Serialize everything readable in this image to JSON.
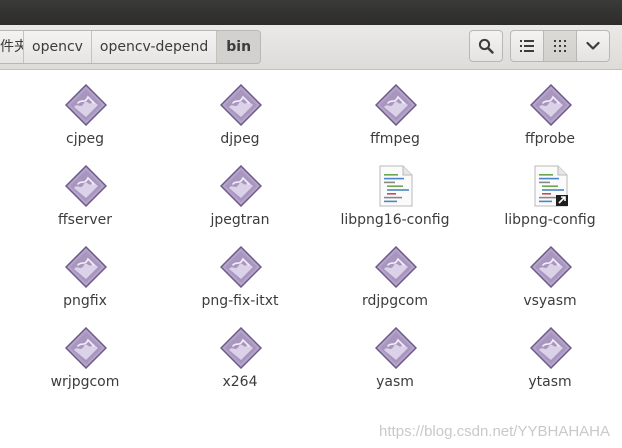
{
  "breadcrumbs": [
    "件夹",
    "opencv",
    "opencv-depend",
    "bin"
  ],
  "toolbar": {
    "search_icon": "search-icon",
    "list_view_icon": "list-view-icon",
    "grid_view_icon": "grid-view-icon",
    "menu_icon": "chevron-down-icon"
  },
  "files": [
    {
      "name": "cjpeg",
      "icon": "executable"
    },
    {
      "name": "djpeg",
      "icon": "executable"
    },
    {
      "name": "ffmpeg",
      "icon": "executable"
    },
    {
      "name": "ffprobe",
      "icon": "executable"
    },
    {
      "name": "ffserver",
      "icon": "executable"
    },
    {
      "name": "jpegtran",
      "icon": "executable"
    },
    {
      "name": "libpng16-config",
      "icon": "script"
    },
    {
      "name": "libpng-config",
      "icon": "script-link"
    },
    {
      "name": "pngfix",
      "icon": "executable"
    },
    {
      "name": "png-fix-itxt",
      "icon": "executable"
    },
    {
      "name": "rdjpgcom",
      "icon": "executable"
    },
    {
      "name": "vsyasm",
      "icon": "executable"
    },
    {
      "name": "wrjpgcom",
      "icon": "executable"
    },
    {
      "name": "x264",
      "icon": "executable"
    },
    {
      "name": "yasm",
      "icon": "executable"
    },
    {
      "name": "ytasm",
      "icon": "executable"
    }
  ],
  "watermark": "https://blog.csdn.net/YYBHAHAHA",
  "colors": {
    "exec_purple": "#9c89b5",
    "window_dark": "#2f2f2e"
  }
}
